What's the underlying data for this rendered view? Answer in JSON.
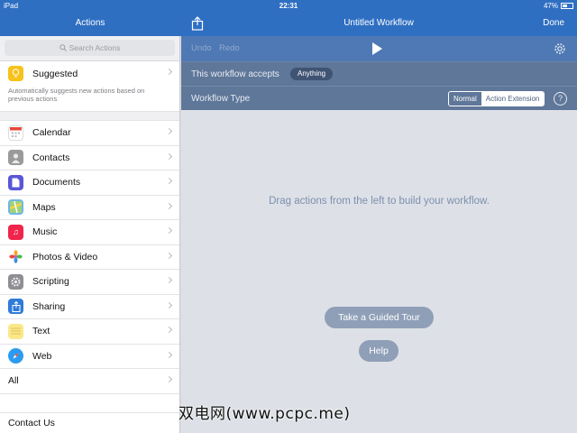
{
  "statusbar": {
    "device": "iPad",
    "time": "22:31",
    "battery": "47%"
  },
  "header": {
    "left_title": "Actions",
    "right_title": "Untitled Workflow",
    "done": "Done"
  },
  "search": {
    "placeholder": "Search Actions"
  },
  "sidebar": {
    "suggested": {
      "label": "Suggested",
      "description": "Automatically suggests new actions based on previous actions",
      "color": "#f7c21b"
    },
    "categories": [
      {
        "label": "Calendar",
        "icon": "calendar-icon",
        "color": "#ffffff"
      },
      {
        "label": "Contacts",
        "icon": "contacts-icon",
        "color": "#9a9a9a"
      },
      {
        "label": "Documents",
        "icon": "documents-icon",
        "color": "#5a56d6"
      },
      {
        "label": "Maps",
        "icon": "maps-icon",
        "color": "#6fb6e8"
      },
      {
        "label": "Music",
        "icon": "music-icon",
        "color": "#f0254c"
      },
      {
        "label": "Photos & Video",
        "icon": "photos-icon",
        "color": "#ffffff"
      },
      {
        "label": "Scripting",
        "icon": "gear-icon",
        "color": "#8e8e93"
      },
      {
        "label": "Sharing",
        "icon": "share-icon",
        "color": "#2f7bd8"
      },
      {
        "label": "Text",
        "icon": "text-icon",
        "color": "#fce88a"
      },
      {
        "label": "Web",
        "icon": "safari-icon",
        "color": "#2a9bf0"
      }
    ],
    "all_label": "All",
    "contact_label": "Contact Us"
  },
  "toolbar": {
    "undo": "Undo",
    "redo": "Redo"
  },
  "workflow": {
    "accepts_label": "This workflow accepts",
    "accepts_value": "Anything",
    "type_label": "Workflow Type",
    "type_options": [
      "Normal",
      "Action Extension"
    ],
    "type_selected": "Action Extension",
    "help": "?"
  },
  "canvas": {
    "hint": "Drag actions from the left to build your workflow.",
    "tour_button": "Take a Guided Tour",
    "help_button": "Help"
  },
  "watermark": "双电网(www.pcpc.me)",
  "colors": {
    "accent": "#2f6fc2",
    "toolbar": "#4f79b4",
    "settings_band": "#5f7799"
  }
}
